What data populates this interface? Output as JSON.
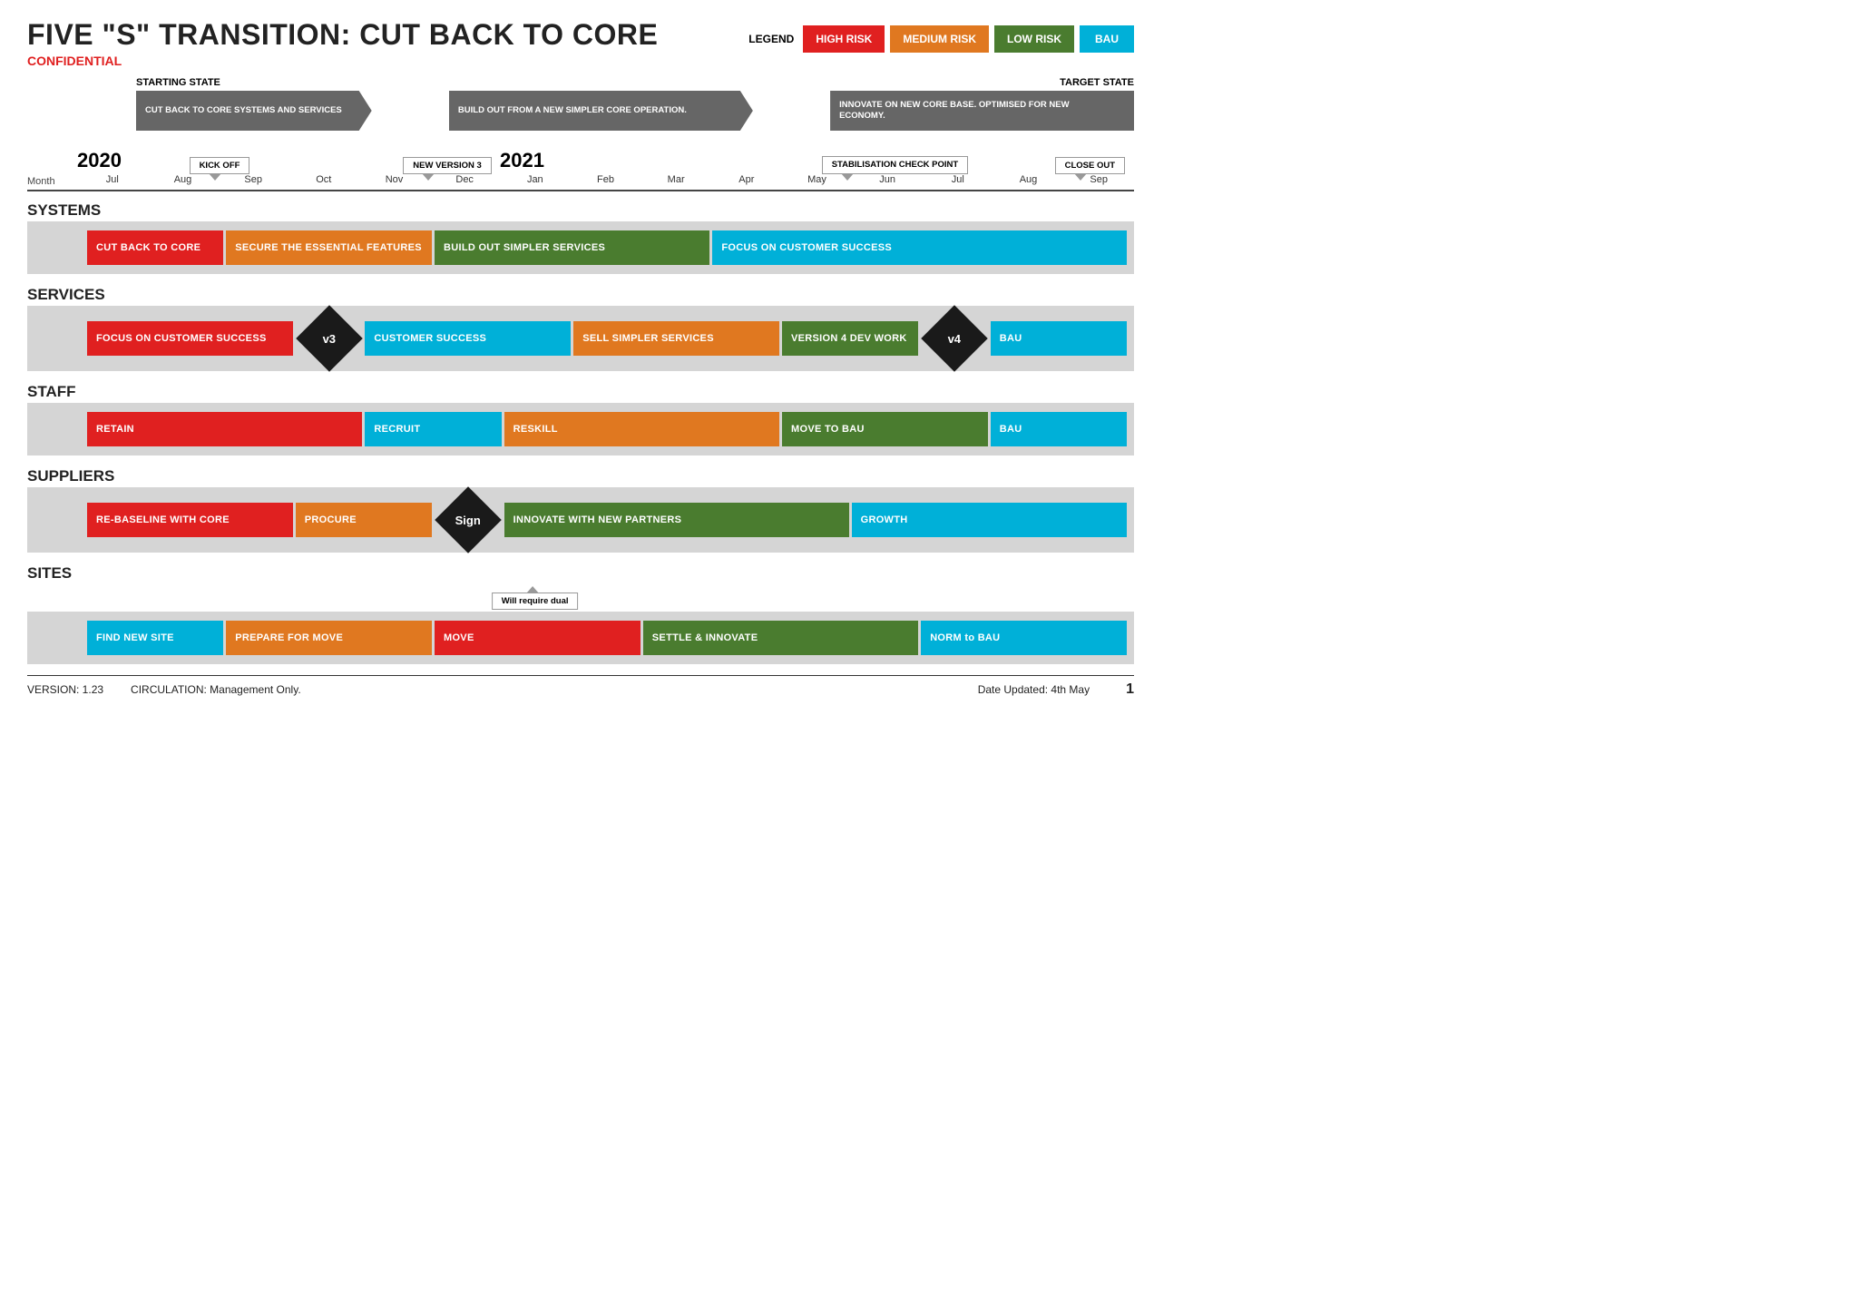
{
  "header": {
    "title": "FIVE \"S\" TRANSITION: CUT BACK TO CORE",
    "confidential": "CONFIDENTIAL",
    "legend_label": "LEGEND",
    "legend_items": [
      {
        "label": "HIGH RISK",
        "color": "red"
      },
      {
        "label": "MEDIUM RISK",
        "color": "orange"
      },
      {
        "label": "LOW RISK",
        "color": "green"
      },
      {
        "label": "BAU",
        "color": "blue"
      }
    ]
  },
  "timeline": {
    "starting_state": "STARTING STATE",
    "target_state": "TARGET STATE",
    "arrows": [
      {
        "text": "CUT BACK TO CORE SYSTEMS AND SERVICES",
        "span": 3
      },
      {
        "text": "BUILD OUT FROM A NEW SIMPLER CORE OPERATION.",
        "span": 4
      },
      {
        "text": "INNOVATE ON NEW CORE BASE. OPTIMISED FOR NEW ECONOMY.",
        "span": 4
      }
    ],
    "callouts_top": [
      {
        "text": "KICK OFF",
        "col": 1
      },
      {
        "text": "NEW VERSION 3",
        "col": 4
      },
      {
        "text": "STABILISATION CHECK POINT",
        "col": 10
      },
      {
        "text": "CLOSE OUT",
        "col": 13
      }
    ],
    "years": [
      {
        "label": "2020",
        "col": 1
      },
      {
        "label": "2021",
        "col": 7
      }
    ],
    "months": [
      "Jul",
      "Aug",
      "Sep",
      "Oct",
      "Nov",
      "Dec",
      "Jan",
      "Feb",
      "Mar",
      "Apr",
      "May",
      "Jun",
      "Jul",
      "Aug",
      "Sep"
    ]
  },
  "sections": [
    {
      "id": "systems",
      "title": "SYSTEMS",
      "bars": [
        {
          "label": "CUT BACK TO CORE",
          "color": "red",
          "start": 0,
          "span": 2
        },
        {
          "label": "SECURE THE ESSENTIAL FEATURES",
          "color": "orange",
          "start": 2,
          "span": 3
        },
        {
          "label": "BUILD OUT SIMPLER SERVICES",
          "color": "green",
          "start": 5,
          "span": 4
        },
        {
          "label": "FOCUS ON CUSTOMER SUCCESS",
          "color": "blue",
          "start": 9,
          "span": 6
        }
      ],
      "diamonds": []
    },
    {
      "id": "services",
      "title": "SERVICES",
      "bars": [
        {
          "label": "FOCUS ON CUSTOMER SUCCESS",
          "color": "red",
          "start": 0,
          "span": 3
        },
        {
          "label": "CUSTOMER SUCCESS",
          "color": "blue",
          "start": 4,
          "span": 3
        },
        {
          "label": "SELL SIMPLER SERVICES",
          "color": "orange",
          "start": 7,
          "span": 3
        },
        {
          "label": "VERSION 4 DEV WORK",
          "color": "green",
          "start": 10,
          "span": 2
        },
        {
          "label": "BAU",
          "color": "blue",
          "start": 13,
          "span": 2
        }
      ],
      "diamonds": [
        {
          "label": "v3",
          "position": 3
        },
        {
          "label": "v4",
          "position": 12
        }
      ]
    },
    {
      "id": "staff",
      "title": "STAFF",
      "bars": [
        {
          "label": "RETAIN",
          "color": "red",
          "start": 0,
          "span": 4
        },
        {
          "label": "RECRUIT",
          "color": "blue",
          "start": 4,
          "span": 2
        },
        {
          "label": "RESKILL",
          "color": "orange",
          "start": 6,
          "span": 4
        },
        {
          "label": "MOVE TO BAU",
          "color": "green",
          "start": 10,
          "span": 3
        },
        {
          "label": "BAU",
          "color": "blue",
          "start": 13,
          "span": 2
        }
      ],
      "diamonds": []
    },
    {
      "id": "suppliers",
      "title": "SUPPLIERS",
      "bars": [
        {
          "label": "RE-BASELINE WITH CORE",
          "color": "red",
          "start": 0,
          "span": 3
        },
        {
          "label": "PROCURE",
          "color": "orange",
          "start": 3,
          "span": 2
        },
        {
          "label": "INNOVATE WITH NEW PARTNERS",
          "color": "green",
          "start": 6,
          "span": 5
        },
        {
          "label": "GROWTH",
          "color": "blue",
          "start": 11,
          "span": 4
        }
      ],
      "diamonds": [
        {
          "label": "Sign",
          "position": 5
        }
      ]
    },
    {
      "id": "sites",
      "title": "SITES",
      "bars": [
        {
          "label": "FIND NEW SITE",
          "color": "blue",
          "start": 0,
          "span": 2
        },
        {
          "label": "PREPARE FOR MOVE",
          "color": "orange",
          "start": 2,
          "span": 3
        },
        {
          "label": "MOVE",
          "color": "red",
          "start": 5,
          "span": 3
        },
        {
          "label": "SETTLE & INNOVATE",
          "color": "green",
          "start": 8,
          "span": 4
        },
        {
          "label": "NORM to BAU",
          "color": "blue",
          "start": 12,
          "span": 3
        }
      ],
      "diamonds": [],
      "callout": {
        "text": "Will require dual",
        "position": 5
      }
    }
  ],
  "footer": {
    "version": "VERSION: 1.23",
    "circulation": "CIRCULATION: Management Only.",
    "date_updated": "Date Updated: 4th May",
    "page": "1"
  }
}
